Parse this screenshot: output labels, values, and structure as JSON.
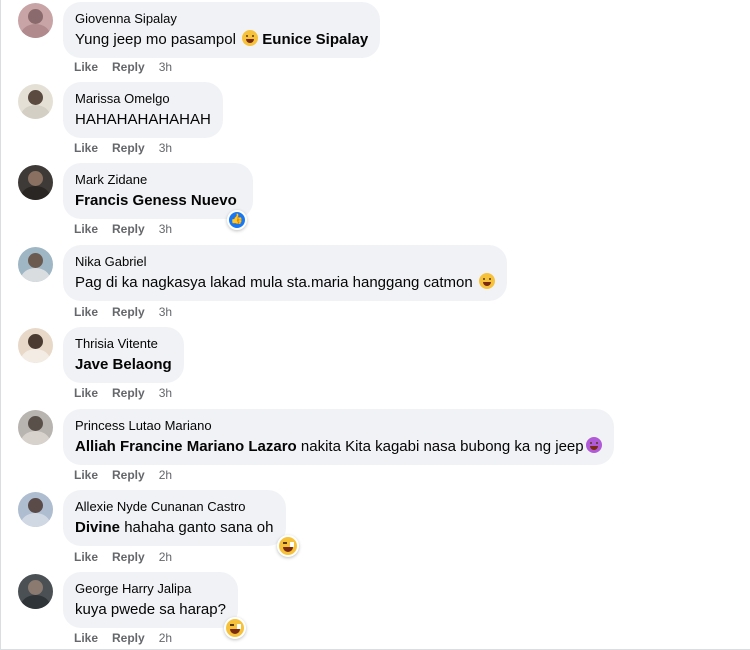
{
  "comments": [
    {
      "author": "Giovenna Sipalay",
      "text": "Yung jeep mo pasampol",
      "emoji": "grinning-squint-emoji",
      "tag": "Eunice Sipalay",
      "like": "Like",
      "reply": "Reply",
      "time": "3h",
      "avatar_colors": {
        "bg": "#c8a4a6",
        "head": "#8a6a6c",
        "body": "#b08a8c"
      }
    },
    {
      "author": "Marissa Omelgo",
      "text": "HAHAHAHAHAHAH",
      "like": "Like",
      "reply": "Reply",
      "time": "3h",
      "avatar_colors": {
        "bg": "#e5e0d6",
        "head": "#5a4a40",
        "body": "#d4cfc4"
      }
    },
    {
      "author": "Mark Zidane",
      "tag": "Francis Geness Nuevo",
      "reaction": "like-reaction-icon",
      "like": "Like",
      "reply": "Reply",
      "time": "3h",
      "avatar_colors": {
        "bg": "#3e3a38",
        "head": "#8a7060",
        "body": "#2a2624"
      }
    },
    {
      "author": "Nika Gabriel",
      "text": "Pag di ka nagkasya lakad mula sta.maria hanggang catmon",
      "emoji": "crying-emoji",
      "like": "Like",
      "reply": "Reply",
      "time": "3h",
      "avatar_colors": {
        "bg": "#9fb6c4",
        "head": "#6a5a50",
        "body": "#d9dde0"
      }
    },
    {
      "author": "Thrisia Vitente",
      "tag": "Jave Belaong",
      "like": "Like",
      "reply": "Reply",
      "time": "3h",
      "avatar_colors": {
        "bg": "#e8d8c8",
        "head": "#4a3a30",
        "body": "#f2ece4"
      }
    },
    {
      "author": "Princess Lutao Mariano",
      "tag": "Alliah Francine Mariano Lazaro",
      "text": "nakita Kita kagabi nasa bubong ka ng jeep",
      "emoji": "purple-devil-emoji",
      "like": "Like",
      "reply": "Reply",
      "time": "2h",
      "avatar_colors": {
        "bg": "#b8b4b0",
        "head": "#5a504a",
        "body": "#d8d2cc"
      }
    },
    {
      "author": "Allexie Nyde Cunanan Castro",
      "tag": "Divine",
      "text": "hahaha ganto sana oh",
      "reaction": "laughing-reaction-icon",
      "like": "Like",
      "reply": "Reply",
      "time": "2h",
      "avatar_colors": {
        "bg": "#aebdd0",
        "head": "#5a4a48",
        "body": "#d0d8e4"
      }
    },
    {
      "author": "George Harry Jalipa",
      "text": "kuya pwede sa harap?",
      "reaction": "laughing-reaction-icon",
      "like": "Like",
      "reply": "Reply",
      "time": "2h",
      "avatar_colors": {
        "bg": "#4a5054",
        "head": "#8a7a70",
        "body": "#2e3438"
      }
    }
  ]
}
